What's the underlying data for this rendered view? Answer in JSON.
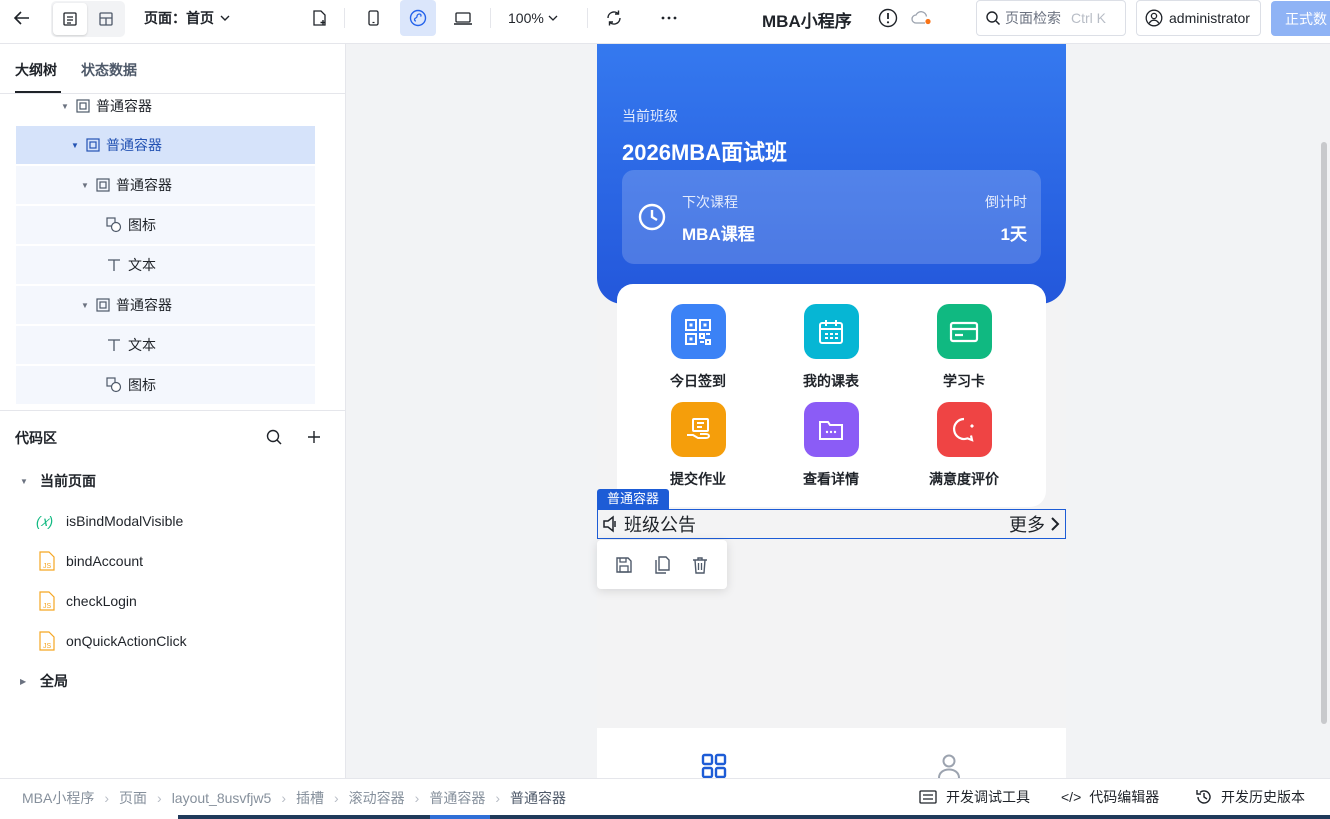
{
  "topbar": {
    "page_selector": "页面：首页",
    "zoom": "100%",
    "app_title": "MBA小程序",
    "search": {
      "placeholder": "页面检索",
      "shortcut": "Ctrl K"
    },
    "user": "administrator",
    "publish": "正式数"
  },
  "left": {
    "tabs": [
      "大纲树",
      "状态数据"
    ],
    "tree": [
      {
        "label": "普通容器",
        "type": "container"
      },
      {
        "label": "普通容器",
        "type": "container"
      },
      {
        "label": "普通容器",
        "type": "container"
      },
      {
        "label": "图标",
        "type": "icon"
      },
      {
        "label": "文本",
        "type": "text"
      },
      {
        "label": "普通容器",
        "type": "container"
      },
      {
        "label": "文本",
        "type": "text"
      },
      {
        "label": "图标",
        "type": "icon"
      }
    ],
    "code": {
      "title": "代码区",
      "current_page": "当前页面",
      "items": [
        "isBindModalVisible",
        "bindAccount",
        "checkLogin",
        "onQuickActionClick"
      ],
      "global": "全局"
    }
  },
  "phone": {
    "class_label": "当前班级",
    "class_name": "2026MBA面试班",
    "next_label": "下次课程",
    "next_value": "MBA课程",
    "countdown_label": "倒计时",
    "countdown_value": "1天",
    "actions": [
      {
        "label": "今日签到",
        "color": "#3b82f6",
        "icon": "qrcode-icon"
      },
      {
        "label": "我的课表",
        "color": "#06b6d4",
        "icon": "calendar-icon"
      },
      {
        "label": "学习卡",
        "color": "#10b981",
        "icon": "card-icon"
      },
      {
        "label": "提交作业",
        "color": "#f59e0b",
        "icon": "submit-icon"
      },
      {
        "label": "查看详情",
        "color": "#8b5cf6",
        "icon": "folder-icon"
      },
      {
        "label": "满意度评价",
        "color": "#ef4444",
        "icon": "chat-icon"
      }
    ],
    "container_tag": "普通容器",
    "notice_title": "班级公告",
    "notice_more": "更多"
  },
  "status": {
    "breadcrumbs": [
      "MBA小程序",
      "页面",
      "layout_8usvfjw5",
      "插槽",
      "滚动容器",
      "普通容器",
      "普通容器"
    ],
    "dev_tools": "开发调试工具",
    "code_editor": "代码编辑器",
    "history": "开发历史版本"
  }
}
